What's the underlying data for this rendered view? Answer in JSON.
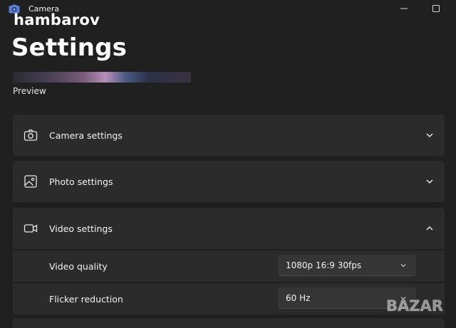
{
  "window": {
    "app_title": "Camera",
    "icons": {
      "app": "camera-app-icon",
      "minimize": "minimize-icon",
      "maximize": "maximize-icon"
    }
  },
  "watermark": {
    "top_text": "hambarov",
    "bottom_text": "BAZAR"
  },
  "page": {
    "title": "Settings"
  },
  "preview": {
    "label": "Preview"
  },
  "sections": {
    "camera": {
      "label": "Camera settings",
      "icon": "camera-icon",
      "expanded": false
    },
    "photo": {
      "label": "Photo settings",
      "icon": "photo-icon",
      "expanded": false
    },
    "video": {
      "label": "Video settings",
      "icon": "video-camera-icon",
      "expanded": true,
      "rows": {
        "quality": {
          "label": "Video quality",
          "value": "1080p 16:9 30fps"
        },
        "flicker": {
          "label": "Flicker reduction",
          "value": "60 Hz"
        }
      }
    }
  },
  "colors": {
    "background": "#202020",
    "card": "#2b2b2b",
    "dropdown": "#353535",
    "text": "#ffffff"
  }
}
